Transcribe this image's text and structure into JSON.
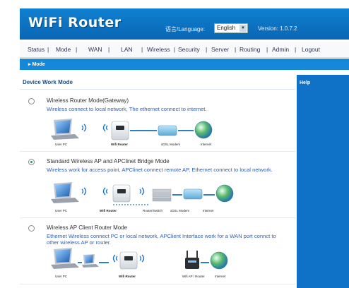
{
  "header": {
    "logo": "WiFi Router",
    "language_label": "语言/Language:",
    "language_value": "English",
    "version": "Version: 1.0.7.2"
  },
  "nav": {
    "items": [
      "Status",
      "Mode",
      "WAN",
      "LAN",
      "Wireless",
      "Security",
      "Server",
      "Routing",
      "Admin",
      "Logout"
    ],
    "separator": "|"
  },
  "breadcrumb": "Mode",
  "section_title": "Device Work Mode",
  "help_title": "Help",
  "options": [
    {
      "title": "Wireless Router Mode(Gateway)",
      "description": "Wireless connect to local network, The ethernet connect to internet.",
      "selected": false,
      "labels": [
        "User PC",
        "Wifi Router",
        "xDSL Modem",
        "Internet"
      ]
    },
    {
      "title": "Standard Wireless AP and APClinet Bridge Mode",
      "description": "Wireless work for access point, APClinet connect remote AP, Ethernet connect to local network.",
      "selected": true,
      "labels": [
        "User PC",
        "Wifi Router",
        "Router/Switch",
        "xDSL Modem",
        "Internet"
      ]
    },
    {
      "title": "Wireless AP Client Router Mode",
      "description": "Ethernet Wireless connect PC or local network, APClient Interface work for a WAN port connct to other wireless AP or router.",
      "selected": false,
      "labels": [
        "User PC",
        "Wifi Router",
        "Wifi AP / Router",
        "Internet"
      ]
    }
  ],
  "colors": {
    "header": "#0a6fc0",
    "accent": "#1688d8",
    "help_panel": "#0f72c6",
    "description": "#2f5fb2"
  },
  "icons": [
    "laptop-icon",
    "wifi-waves-icon",
    "router-device-icon",
    "modem-icon",
    "globe-icon",
    "switch-icon",
    "ap-icon"
  ]
}
